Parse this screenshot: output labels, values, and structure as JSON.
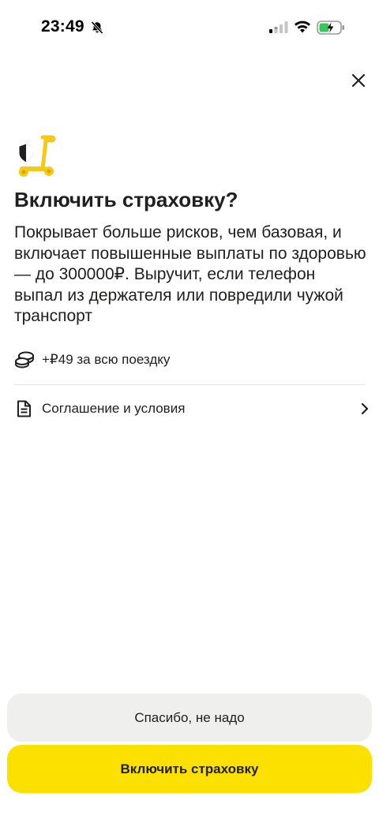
{
  "status_bar": {
    "time": "23:49",
    "icons": [
      "bell-muted-icon",
      "signal-icon",
      "wifi-icon",
      "battery-charging-icon"
    ]
  },
  "close_icon": "close-icon",
  "header_icon": "scooter-shield-icon",
  "title": "Включить страховку?",
  "description": "Покрывает больше рисков, чем базовая, и включает повышенные выплаты по здоровью — до 300000₽. Выручит, если телефон выпал из держателя или повредили чужой транспорт",
  "price": {
    "icon": "coins-icon",
    "text": "+₽49 за всю поездку"
  },
  "terms": {
    "icon": "document-icon",
    "label": "Соглашение и условия",
    "chevron": "chevron-right-icon"
  },
  "buttons": {
    "decline_label": "Спасибо, не надо",
    "accept_label": "Включить страховку"
  },
  "colors": {
    "accent": "#fce000",
    "secondary_button": "#efefee",
    "text": "#21201f",
    "battery_green": "#34c759"
  }
}
